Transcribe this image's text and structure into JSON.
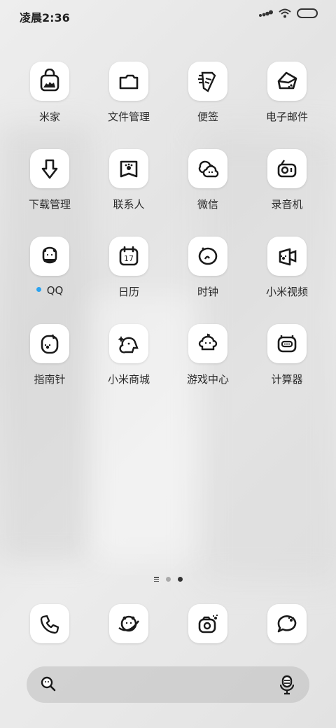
{
  "status_bar": {
    "time": "凌晨2:36"
  },
  "apps": [
    {
      "label": "米家",
      "icon": "mijia-bag-icon"
    },
    {
      "label": "文件管理",
      "icon": "folder-icon"
    },
    {
      "label": "便签",
      "icon": "notes-icon"
    },
    {
      "label": "电子邮件",
      "icon": "email-icon"
    },
    {
      "label": "下载管理",
      "icon": "download-icon"
    },
    {
      "label": "联系人",
      "icon": "contacts-icon"
    },
    {
      "label": "微信",
      "icon": "wechat-icon"
    },
    {
      "label": "录音机",
      "icon": "recorder-icon"
    },
    {
      "label": "QQ",
      "icon": "qq-icon",
      "has_new_dot": true
    },
    {
      "label": "日历",
      "icon": "calendar-icon",
      "calendar_day": "17"
    },
    {
      "label": "时钟",
      "icon": "clock-icon"
    },
    {
      "label": "小米视频",
      "icon": "video-icon"
    },
    {
      "label": "指南针",
      "icon": "compass-icon"
    },
    {
      "label": "小米商城",
      "icon": "mall-icon"
    },
    {
      "label": "游戏中心",
      "icon": "game-center-icon"
    },
    {
      "label": "计算器",
      "icon": "calculator-icon"
    }
  ],
  "dock": [
    {
      "icon": "phone-icon"
    },
    {
      "icon": "browser-icon"
    },
    {
      "icon": "camera-icon"
    },
    {
      "icon": "messages-icon"
    }
  ],
  "page_indicator": {
    "pages": 2,
    "active": 2
  },
  "colors": {
    "new_dot": "#2ba3f0",
    "icon_bg": "#ffffff",
    "stroke": "#1a1a1a"
  }
}
